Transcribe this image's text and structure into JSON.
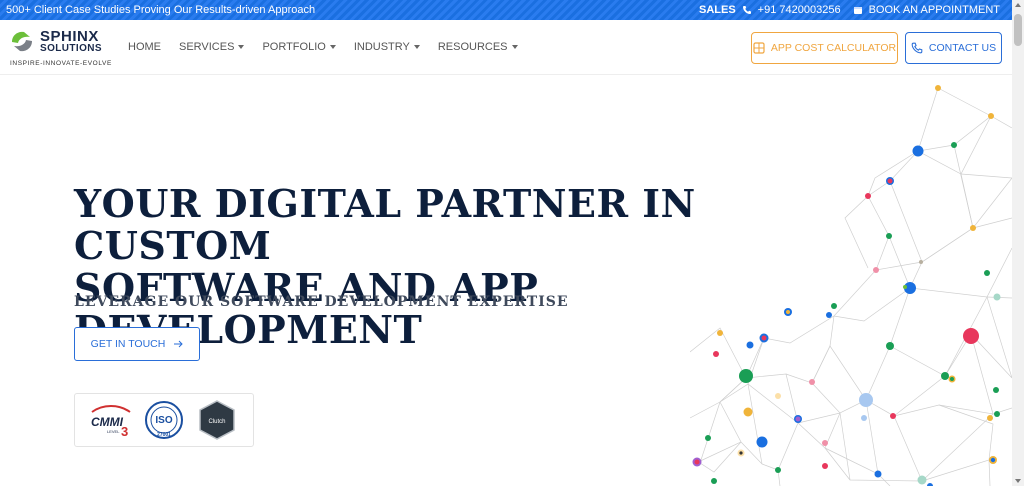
{
  "topbar": {
    "promo": "500+ Client Case Studies Proving Our Results-driven Approach",
    "sales_label": "SALES",
    "phone": "+91 7420003256",
    "book_label": "BOOK AN APPOINTMENT"
  },
  "logo": {
    "name_line1": "SPHINX",
    "name_line2": "SOLUTIONS",
    "tagline": "INSPIRE-INNOVATE-EVOLVE"
  },
  "nav": {
    "items": [
      {
        "label": "HOME",
        "dropdown": false
      },
      {
        "label": "SERVICES",
        "dropdown": true
      },
      {
        "label": "PORTFOLIO",
        "dropdown": true
      },
      {
        "label": "INDUSTRY",
        "dropdown": true
      },
      {
        "label": "RESOURCES",
        "dropdown": true
      }
    ],
    "calc_label": "APP COST CALCULATOR",
    "contact_label": "CONTACT US"
  },
  "hero": {
    "headline_line1": "YOUR DIGITAL PARTNER IN CUSTOM",
    "headline_line2": "SOFTWARE AND APP DEVELOPMENT",
    "subhead": "LEVERAGE OUR SOFTWARE DEVELOPMENT EXPERTISE",
    "cta_label": "GET IN TOUCH"
  },
  "badges": {
    "cmmi_text": "CMMI",
    "cmmi_level": "3",
    "cmmi_sub": "LEVEL",
    "iso_text": "ISO",
    "iso_num": "27001",
    "clutch_text": "Clutch"
  },
  "colors": {
    "brand_blue": "#2a6ed8",
    "accent_orange": "#f0a640",
    "headline_navy": "#0d1f3c",
    "logo_green": "#6cbf3a"
  }
}
